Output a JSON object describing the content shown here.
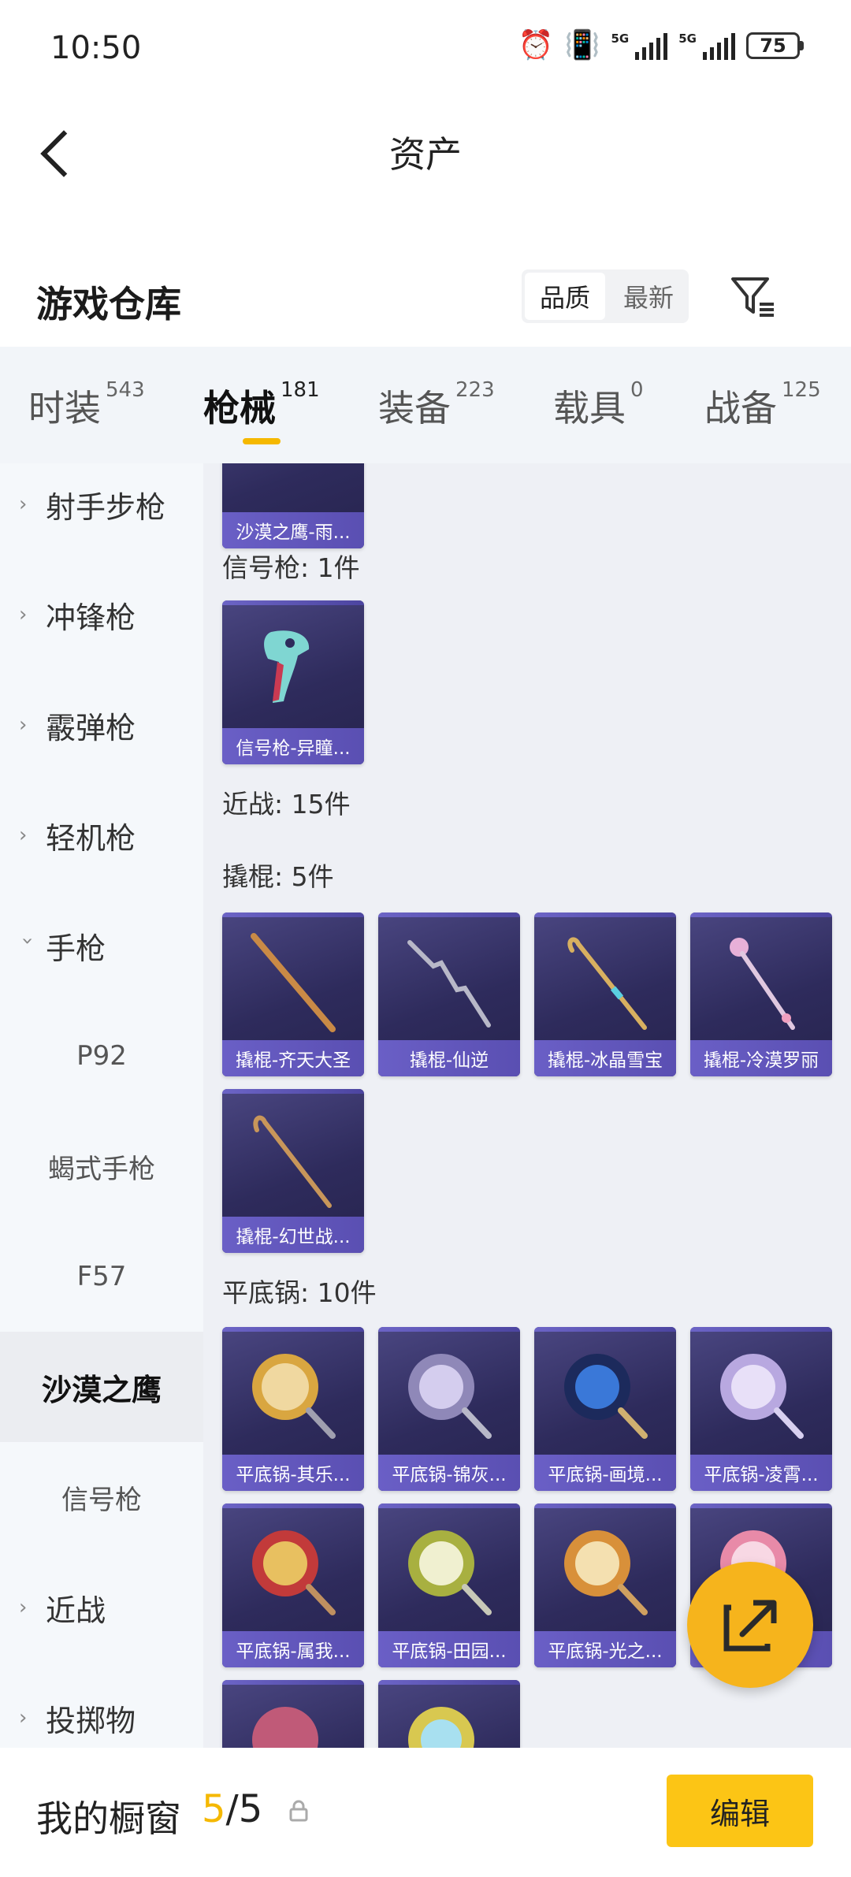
{
  "status_bar": {
    "time": "10:50",
    "battery": "75",
    "signal_labels": [
      "5G",
      "5G"
    ]
  },
  "header": {
    "title": "资产"
  },
  "section": {
    "title": "游戏仓库",
    "sort_options": [
      "品质",
      "最新"
    ],
    "sort_selected": "品质"
  },
  "tabs": [
    {
      "label": "时装",
      "count": "543"
    },
    {
      "label": "枪械",
      "count": "181"
    },
    {
      "label": "装备",
      "count": "223"
    },
    {
      "label": "载具",
      "count": "0"
    },
    {
      "label": "战备",
      "count": "125"
    }
  ],
  "sidebar": {
    "items": [
      {
        "label": "射手步枪"
      },
      {
        "label": "冲锋枪"
      },
      {
        "label": "霰弹枪"
      },
      {
        "label": "轻机枪"
      },
      {
        "label": "手枪"
      },
      {
        "label": "近战"
      },
      {
        "label": "投掷物"
      }
    ],
    "subitems": [
      {
        "label": "P92"
      },
      {
        "label": "蝎式手枪"
      },
      {
        "label": "F57"
      },
      {
        "label": "沙漠之鹰"
      },
      {
        "label": "信号枪"
      }
    ]
  },
  "content": {
    "top_card": "沙漠之鹰-雨...",
    "groups": {
      "signal": "信号枪: 1件",
      "melee": "近战: 15件",
      "crowbar": "撬棍: 5件",
      "pan": "平底锅: 10件"
    },
    "signal_cards": [
      "信号枪-异瞳..."
    ],
    "crowbar_cards": [
      "撬棍-齐天大圣",
      "撬棍-仙逆",
      "撬棍-冰晶雪宝",
      "撬棍-冷漠罗丽",
      "撬棍-幻世战..."
    ],
    "pan_cards": [
      "平底锅-其乐...",
      "平底锅-锦灰...",
      "平底锅-画境...",
      "平底锅-凌霄...",
      "平底锅-属我...",
      "平底锅-田园...",
      "平底锅-光之..."
    ]
  },
  "bottom_bar": {
    "label": "我的橱窗",
    "current": "5",
    "separator": "/",
    "total": "5",
    "edit_label": "编辑"
  },
  "icons": {
    "back": "back-arrow-icon",
    "filter": "filter-icon",
    "share": "share-icon",
    "lock": "lock-icon"
  },
  "colors": {
    "accent": "#f5b800",
    "card_bg": "#2e2b5c",
    "card_label": "#6a5fc6",
    "fab": "#f6b41c"
  }
}
